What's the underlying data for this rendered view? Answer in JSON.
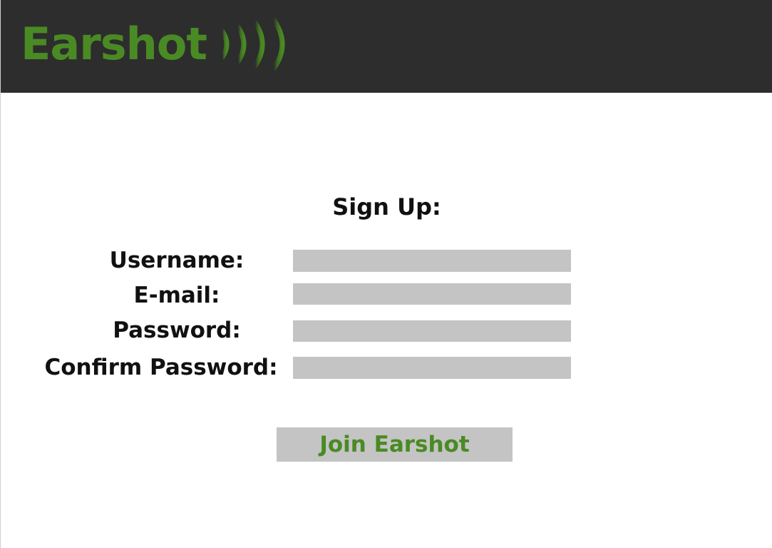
{
  "brand": {
    "name": "Earshot",
    "logo_icon": "sound-waves-icon",
    "color": "#4a8a24"
  },
  "header": {
    "background": "#2d2d2d"
  },
  "form": {
    "title": "Sign Up:",
    "fields": [
      {
        "label": "Username:",
        "value": "",
        "placeholder": ""
      },
      {
        "label": "E-mail:",
        "value": "",
        "placeholder": ""
      },
      {
        "label": "Password:",
        "value": "",
        "placeholder": ""
      },
      {
        "label": "Confirm Password:",
        "value": "",
        "placeholder": ""
      }
    ],
    "field_color": "#c4c4c4",
    "submit_label": "Join Earshot"
  }
}
